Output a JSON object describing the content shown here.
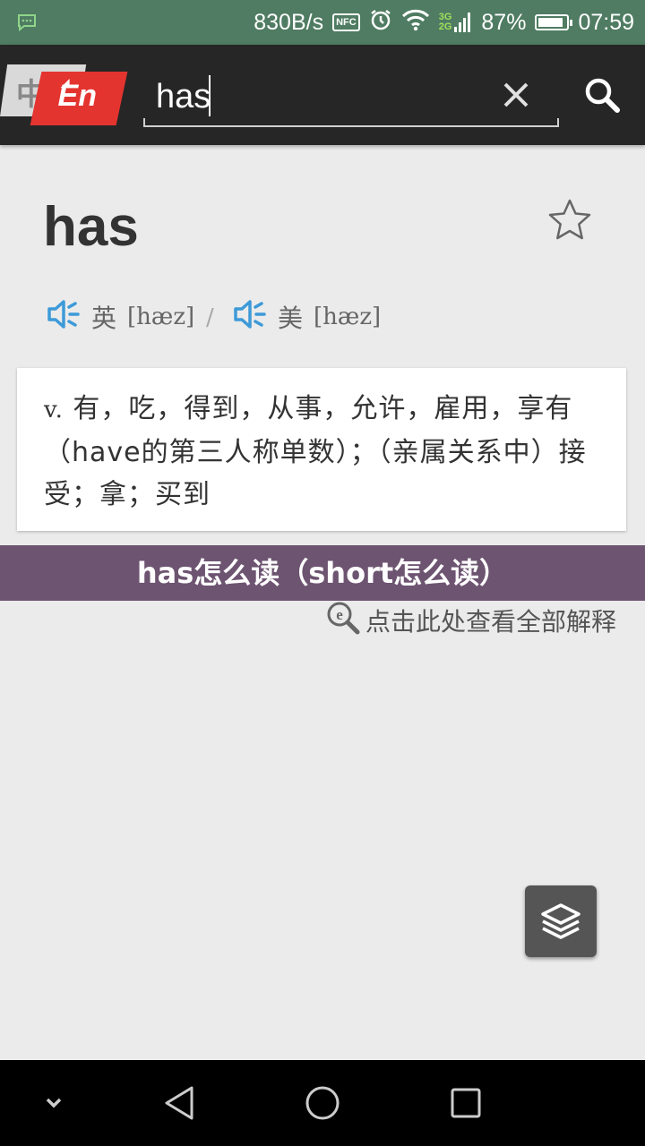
{
  "status_bar": {
    "net_speed": "830B/s",
    "nfc": "NFC",
    "network_types": [
      "3G",
      "2G"
    ],
    "battery": "87%",
    "battery_level": 0.87,
    "time": "07:59",
    "icons": [
      "message-icon",
      "nfc-icon",
      "alarm-icon",
      "wifi-icon",
      "signal-icon",
      "battery-icon"
    ]
  },
  "toolbar": {
    "lang_from": "中",
    "lang_to": "En",
    "search_value": "has",
    "clear_icon": "close-icon",
    "search_icon": "search-icon"
  },
  "entry": {
    "word": "has",
    "pron_uk_label": "英",
    "pron_uk_ipa": "[hæz]",
    "separator": "/",
    "pron_us_label": "美",
    "pron_us_ipa": "[hæz]",
    "pos": "v.",
    "definition": "有，吃，得到，从事，允许，雇用，享有（have的第三人称单数）；（亲属关系中）接受；拿；买到"
  },
  "banner": {
    "text": "has怎么读（short怎么读）"
  },
  "more_link": {
    "text": "点击此处查看全部解释"
  },
  "colors": {
    "status_bar": "#4f7c62",
    "toolbar": "#262626",
    "lang_en_accent": "#e4342f",
    "speaker_icon": "#3d9ad8",
    "banner": "#6d5471",
    "background": "#ebebeb"
  }
}
